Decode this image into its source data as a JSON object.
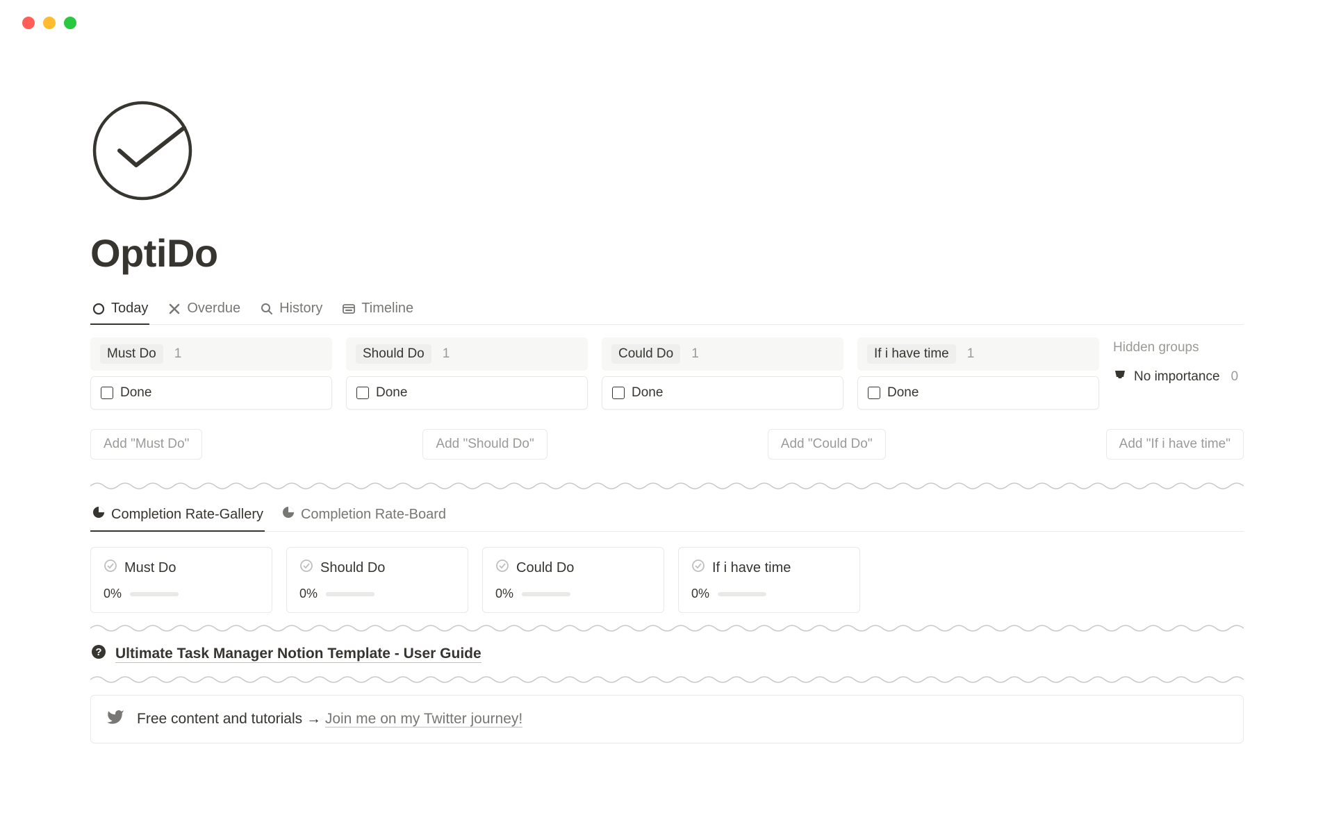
{
  "page": {
    "title": "OptiDo"
  },
  "tabs": [
    {
      "label": "Today",
      "icon": "circle-icon"
    },
    {
      "label": "Overdue",
      "icon": "x-icon"
    },
    {
      "label": "History",
      "icon": "search-icon"
    },
    {
      "label": "Timeline",
      "icon": "timeline-icon"
    }
  ],
  "board": {
    "columns": [
      {
        "label": "Must Do",
        "count": "1",
        "card": "Done",
        "add": "Add \"Must Do\""
      },
      {
        "label": "Should Do",
        "count": "1",
        "card": "Done",
        "add": "Add \"Should Do\""
      },
      {
        "label": "Could Do",
        "count": "1",
        "card": "Done",
        "add": "Add \"Could Do\""
      },
      {
        "label": "If i have time",
        "count": "1",
        "card": "Done",
        "add": "Add \"If i have time\""
      }
    ],
    "hidden": {
      "title": "Hidden groups",
      "item": "No importance",
      "count": "0"
    }
  },
  "subtabs": [
    {
      "label": "Completion Rate-Gallery"
    },
    {
      "label": "Completion Rate-Board"
    }
  ],
  "gallery": [
    {
      "label": "Must Do",
      "percent": "0%"
    },
    {
      "label": "Should Do",
      "percent": "0%"
    },
    {
      "label": "Could Do",
      "percent": "0%"
    },
    {
      "label": "If i have time",
      "percent": "0%"
    }
  ],
  "guide": {
    "text": "Ultimate Task Manager Notion Template - User Guide"
  },
  "callout": {
    "prefix": "Free content and tutorials ",
    "arrow": "→ ",
    "link": "Join me on my Twitter journey!"
  }
}
